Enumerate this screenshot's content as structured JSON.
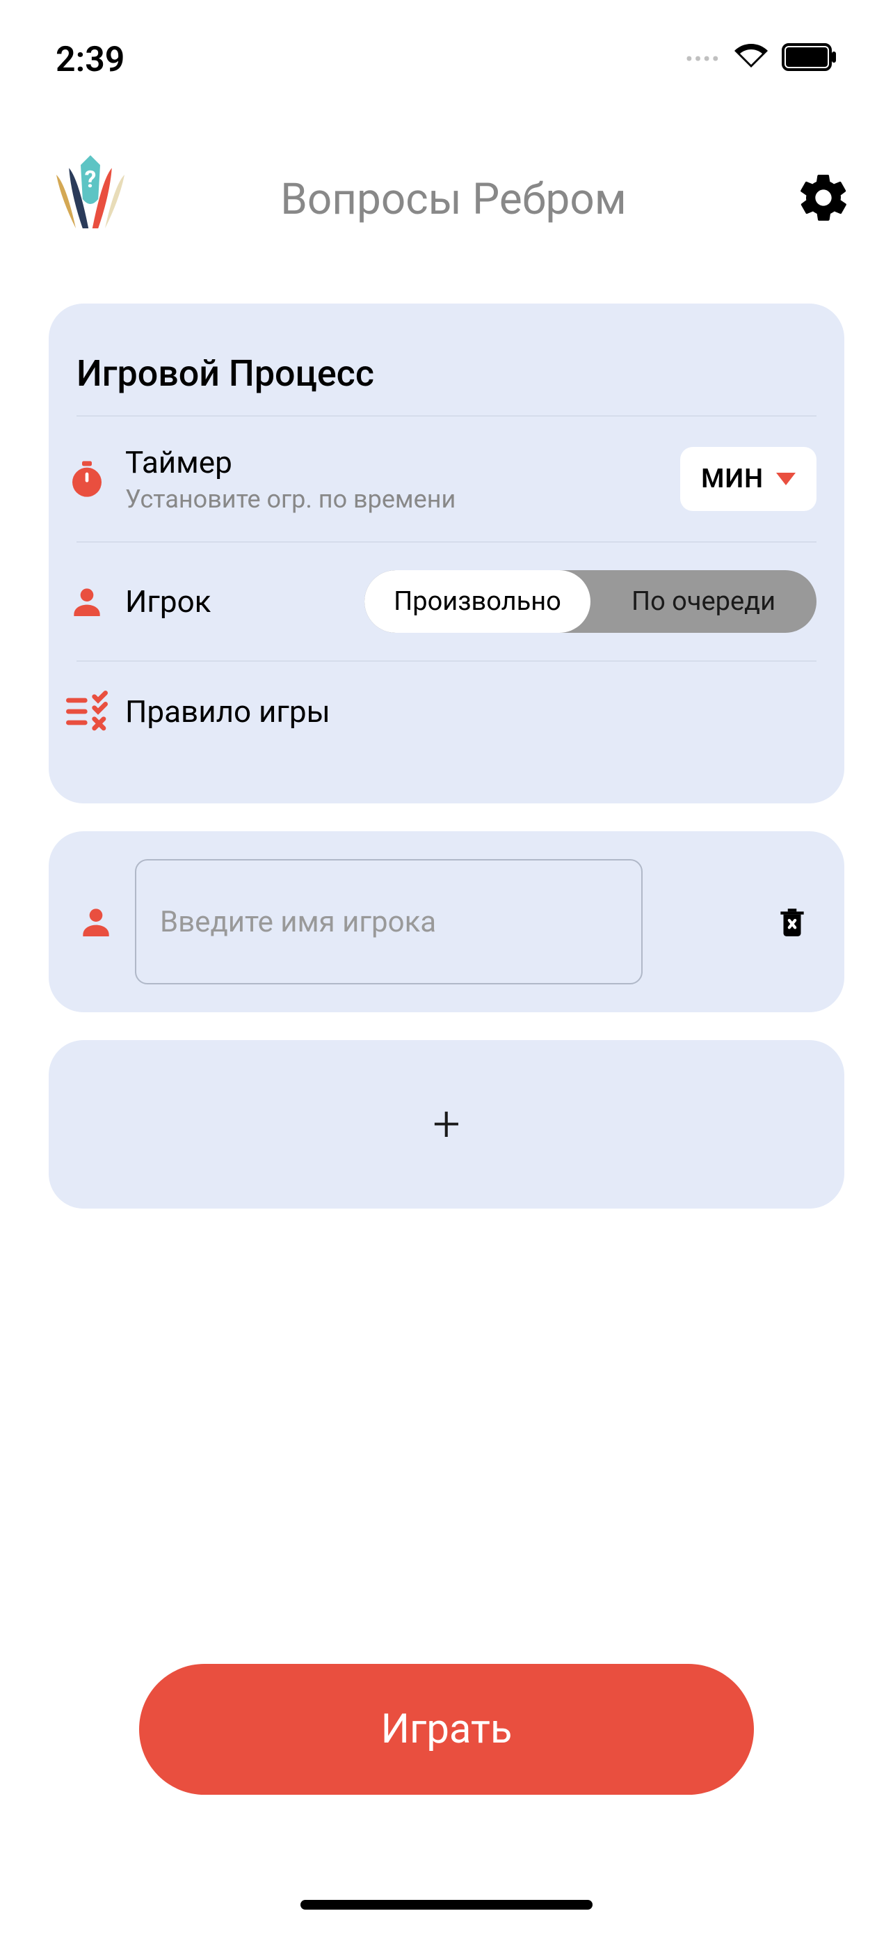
{
  "status": {
    "time": "2:39"
  },
  "header": {
    "title": "Вопросы Ребром"
  },
  "gameplay": {
    "section_title": "Игровой Процесс",
    "timer": {
      "label": "Таймер",
      "sublabel": "Установите огр. по времени",
      "dropdown": "МИН"
    },
    "player": {
      "label": "Игрок",
      "option_random": "Произвольно",
      "option_sequential": "По очереди"
    },
    "rules": {
      "label": "Правило игры"
    }
  },
  "player_input": {
    "placeholder": "Введите имя игрока"
  },
  "play_button": "Играть"
}
